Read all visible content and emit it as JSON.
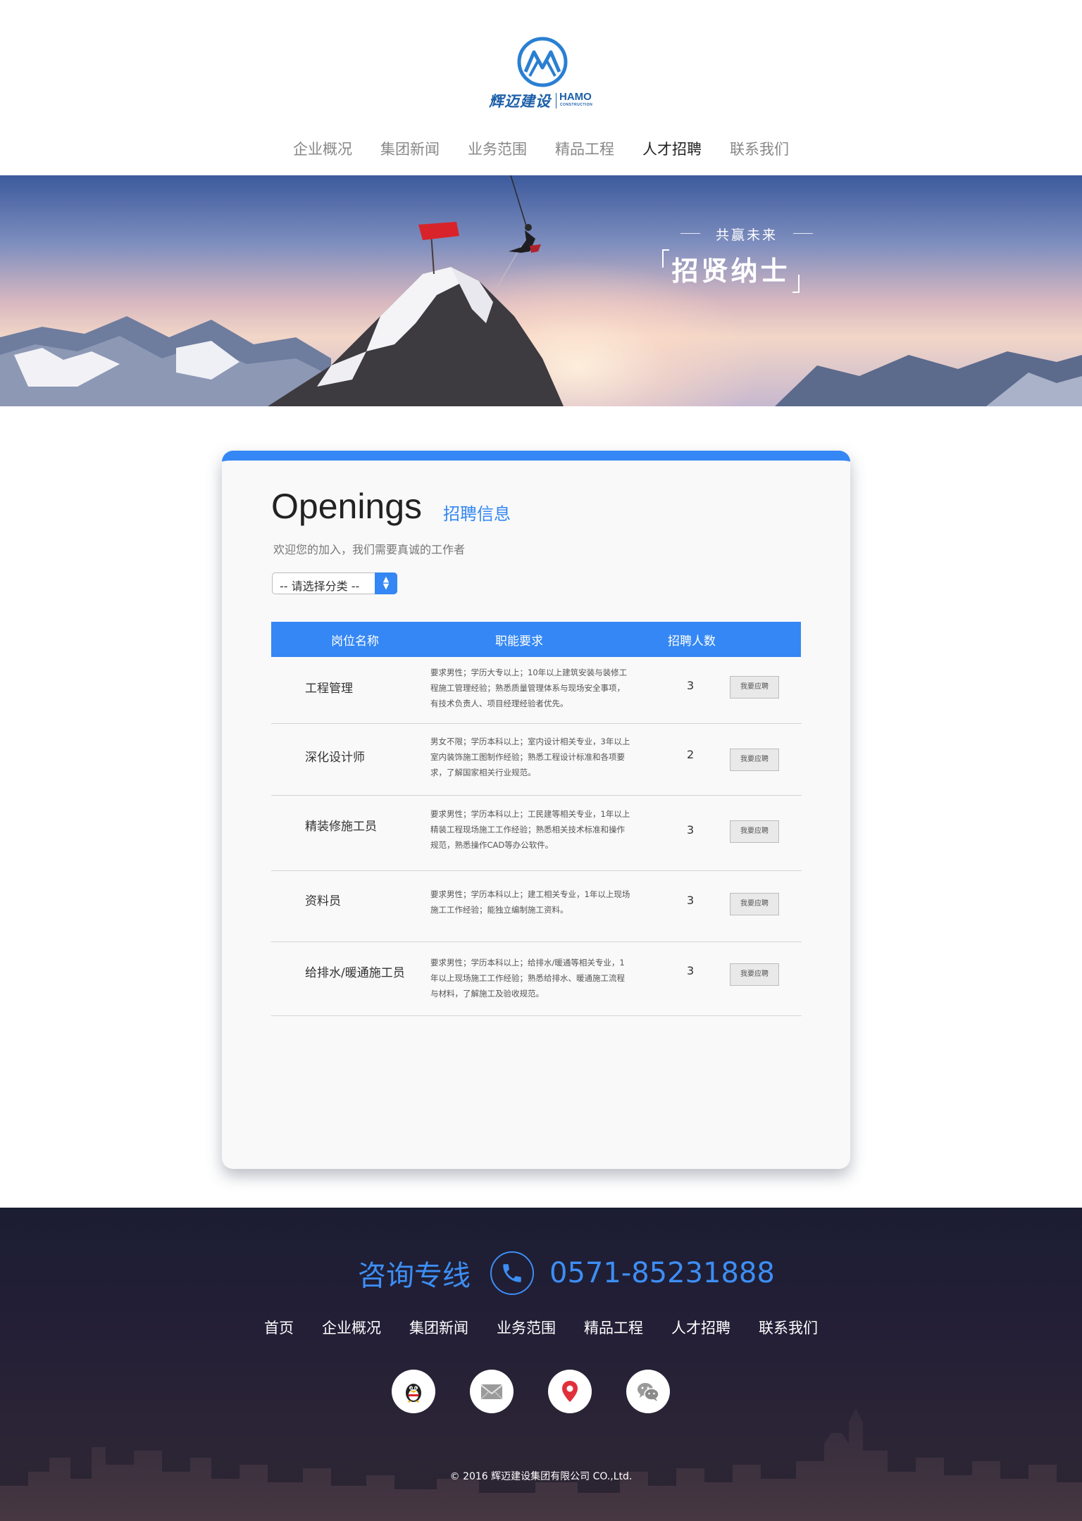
{
  "brand": {
    "name_cn": "辉迈建设",
    "name_en": "HAMO",
    "name_en_sub": "CONSTRUCTION",
    "color": "#1c5fa8"
  },
  "nav": {
    "items": [
      {
        "label": "企业概况",
        "active": false
      },
      {
        "label": "集团新闻",
        "active": false
      },
      {
        "label": "业务范围",
        "active": false
      },
      {
        "label": "精品工程",
        "active": false
      },
      {
        "label": "人才招聘",
        "active": true
      },
      {
        "label": "联系我们",
        "active": false
      }
    ]
  },
  "banner": {
    "small_text": "共赢未来",
    "big_text": "招贤纳士"
  },
  "openings": {
    "title": "Openings",
    "title_cn": "招聘信息",
    "subtitle": "欢迎您的加入，我们需要真诚的工作者",
    "select_value": "-- 请选择分类 --",
    "accent_color": "#3487f4",
    "columns": [
      "岗位名称",
      "职能要求",
      "招聘人数"
    ],
    "apply_label": "我要应聘",
    "rows": [
      {
        "position": "工程管理",
        "requirements": [
          "要求男性；学历大专以上；10年以上建筑安装与装修工",
          "程施工管理经验；熟悉质量管理体系与现场安全事项，",
          "有技术负责人、项目经理经验者优先。"
        ],
        "count": "3"
      },
      {
        "position": "深化设计师",
        "requirements": [
          "男女不限；学历本科以上；室内设计相关专业，3年以上",
          "室内装饰施工图制作经验；熟悉工程设计标准和各项要",
          "求，了解国家相关行业规范。"
        ],
        "count": "2"
      },
      {
        "position": "精装修施工员",
        "requirements": [
          "要求男性；学历本科以上；工民建等相关专业，1年以上",
          "精装工程现场施工工作经验；熟悉相关技术标准和操作",
          "规范，熟悉操作CAD等办公软件。"
        ],
        "count": "3"
      },
      {
        "position": "资料员",
        "requirements": [
          "要求男性；学历本科以上；建工相关专业，1年以上现场",
          "施工工作经验；能独立编制施工资料。"
        ],
        "count": "3"
      },
      {
        "position": "给排水/暖通施工员",
        "requirements": [
          "要求男性；学历本科以上；给排水/暖通等相关专业，1",
          "年以上现场施工工作经验；熟悉给排水、暖通施工流程",
          "与材料，了解施工及验收规范。"
        ],
        "count": "3"
      }
    ]
  },
  "footer": {
    "hotline_label": "咨询专线",
    "hotline_number": "0571-85231888",
    "hotline_color": "#3d8ef4",
    "nav": [
      "首页",
      "企业概况",
      "集团新闻",
      "业务范围",
      "精品工程",
      "人才招聘",
      "联系我们"
    ],
    "social_icons": [
      "qq-icon",
      "mail-icon",
      "location-icon",
      "wechat-icon"
    ],
    "copyright": "© 2016 辉迈建设集团有限公司 CO.,Ltd."
  }
}
